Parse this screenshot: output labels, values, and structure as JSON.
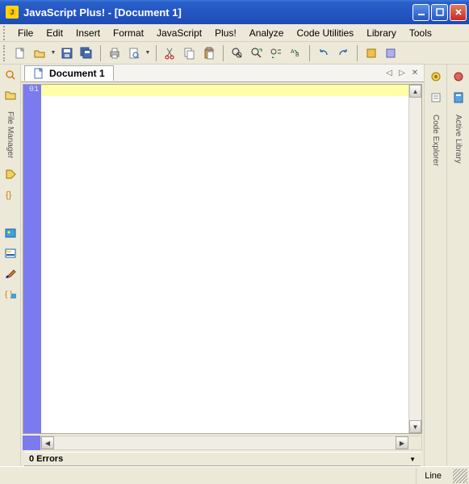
{
  "window": {
    "title": "JavaScript Plus! - [Document 1]"
  },
  "menu": {
    "file": "File",
    "edit": "Edit",
    "insert": "Insert",
    "format": "Format",
    "javascript": "JavaScript",
    "plus": "Plus!",
    "analyze": "Analyze",
    "code_utilities": "Code Utilities",
    "library": "Library",
    "tools": "Tools"
  },
  "tabs": {
    "doc1": "Document 1"
  },
  "editor": {
    "line_number": "01"
  },
  "left_panel": {
    "file_manager": "File Manager"
  },
  "right_panel": {
    "code_explorer": "Code Explorer",
    "active_library": "Active Library"
  },
  "errors": {
    "label": "0 Errors"
  },
  "status": {
    "line": "Line"
  }
}
